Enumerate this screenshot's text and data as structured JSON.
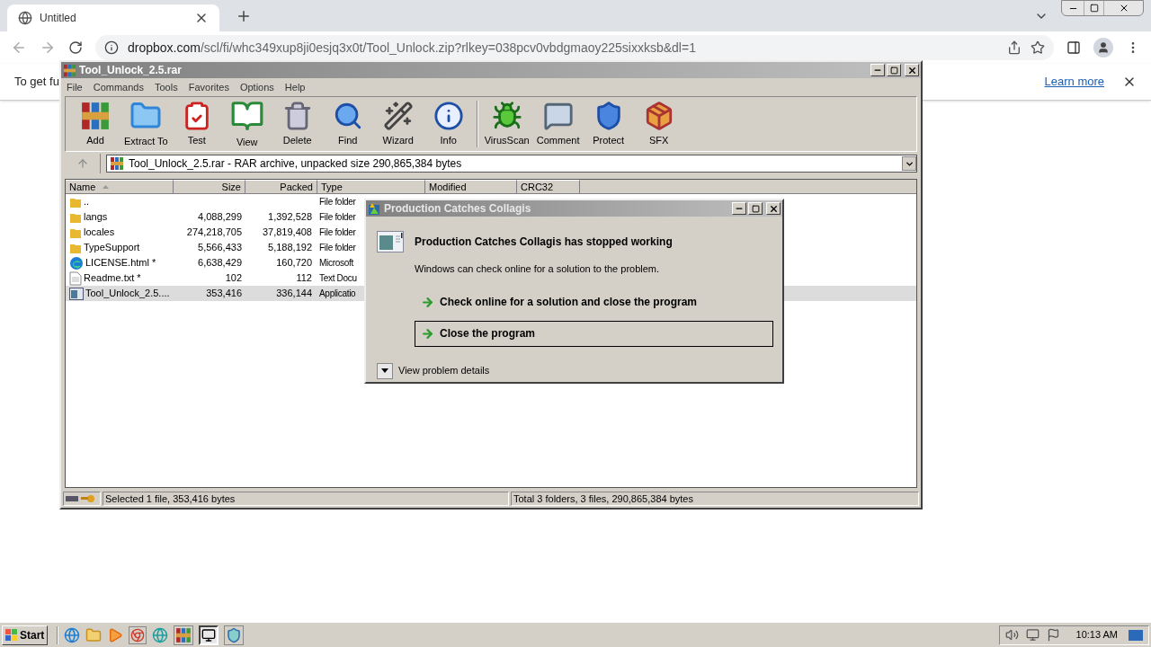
{
  "browser": {
    "tab": {
      "title": "Untitled"
    },
    "url": {
      "domain": "dropbox.com",
      "path": "/scl/fi/whc349xup8ji0esjq3x0t/Tool_Unlock.zip?rlkey=038pcv0vbdgmaoy225sixxksb&dl=1"
    },
    "infobar": {
      "text": "To get fu",
      "link": "Learn more"
    }
  },
  "winrar": {
    "title": "Tool_Unlock_2.5.rar",
    "menu": [
      "File",
      "Commands",
      "Tools",
      "Favorites",
      "Options",
      "Help"
    ],
    "toolbar": [
      [
        "Add",
        "Extract To",
        "Test",
        "View",
        "Delete",
        "Find",
        "Wizard",
        "Info"
      ],
      [
        "VirusScan",
        "Comment",
        "Protect",
        "SFX"
      ]
    ],
    "path": "Tool_Unlock_2.5.rar - RAR archive, unpacked size 290,865,384 bytes",
    "columns": [
      "Name",
      "Size",
      "Packed",
      "Type",
      "Modified",
      "CRC32"
    ],
    "rows": [
      {
        "kind": "folder",
        "name": "..",
        "size": "",
        "packed": "",
        "type": "File folder",
        "selected": false
      },
      {
        "kind": "folder",
        "name": "langs",
        "size": "4,088,299",
        "packed": "1,392,528",
        "type": "File folder",
        "selected": false
      },
      {
        "kind": "folder",
        "name": "locales",
        "size": "274,218,705",
        "packed": "37,819,408",
        "type": "File folder",
        "selected": false
      },
      {
        "kind": "folder",
        "name": "TypeSupport",
        "size": "5,566,433",
        "packed": "5,188,192",
        "type": "File folder",
        "selected": false
      },
      {
        "kind": "web",
        "name": "LICENSE.html *",
        "size": "6,638,429",
        "packed": "160,720",
        "type": "Microsoft",
        "selected": false
      },
      {
        "kind": "text",
        "name": "Readme.txt *",
        "size": "102",
        "packed": "112",
        "type": "Text Docu",
        "selected": false
      },
      {
        "kind": "app",
        "name": "Tool_Unlock_2.5....",
        "size": "353,416",
        "packed": "336,144",
        "type": "Applicatio",
        "selected": true
      }
    ],
    "status": {
      "left": "Selected 1 file, 353,416 bytes",
      "right": "Total 3 folders, 3 files, 290,865,384 bytes"
    }
  },
  "dialog": {
    "title": "Production Catches Collagis",
    "heading": "Production Catches Collagis has stopped working",
    "message": "Windows can check online for a solution to the problem.",
    "options": [
      {
        "label": "Check online for a solution and close the program",
        "selected": false
      },
      {
        "label": "Close the program",
        "selected": true
      }
    ],
    "details": {
      "label": "View problem details",
      "expanded": false
    }
  },
  "taskbar": {
    "start": "Start",
    "clock": "10:13 AM"
  }
}
